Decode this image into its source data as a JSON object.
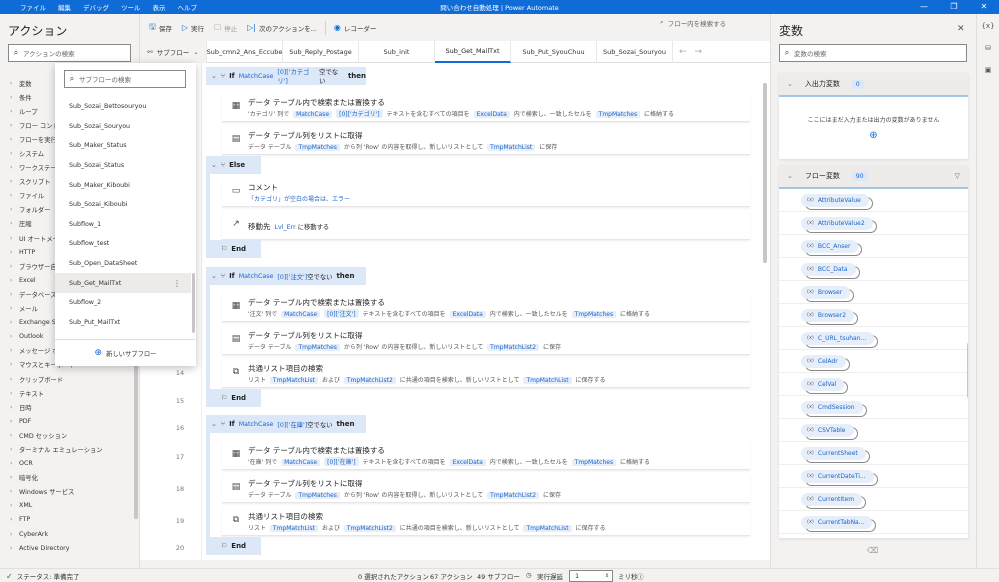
{
  "window": {
    "menu": [
      "ファイル",
      "編集",
      "デバッグ",
      "ツール",
      "表示",
      "ヘルプ"
    ],
    "title": "問い合わせ自動処理 | Power Automate",
    "controls": [
      "minimize-icon",
      "restore-icon",
      "close-icon"
    ]
  },
  "actions_panel": {
    "title": "アクション",
    "search_placeholder": "アクションの検索",
    "categories": [
      "変数",
      "条件",
      "ループ",
      "フロー コントロール",
      "フローを実行する",
      "システム",
      "ワークステーション",
      "スクリプト",
      "ファイル",
      "フォルダー",
      "圧縮",
      "UI オートメーション",
      "HTTP",
      "ブラウザー自動化",
      "Excel",
      "データベース",
      "メール",
      "Exchange Server",
      "Outlook",
      "メッセージ ボックス",
      "マウスとキーボード",
      "クリップボード",
      "テキスト",
      "日時",
      "PDF",
      "CMD セッション",
      "ターミナル エミュレーション",
      "OCR",
      "暗号化",
      "Windows サービス",
      "XML",
      "FTP",
      "CyberArk",
      "Active Directory"
    ]
  },
  "toolbar": {
    "save": "保存",
    "run": "実行",
    "stop": "停止",
    "next_action": "次のアクションを...",
    "recorder": "レコーダー",
    "flow_search_placeholder": "フロー内を検索する"
  },
  "tabs": {
    "subflow_button": "サブフロー",
    "items": [
      "Sub_cmn2_Ans_Eccube",
      "Sub_Reply_Postage",
      "Sub_init",
      "Sub_Get_MailTxt",
      "Sub_Put_SyouChuu",
      "Sub_Sozai_Souryou"
    ],
    "active_index": 3
  },
  "subflow_dropdown": {
    "search_placeholder": "サブフローの検索",
    "items": [
      "Sub_Sozai_Bettosouryou",
      "Sub_Sozai_Souryou",
      "Sub_Maker_Status",
      "Sub_Sozai_Status",
      "Sub_Maker_Kiboubi",
      "Sub_Sozai_Kiboubi",
      "Subflow_1",
      "Subflow_test",
      "Sub_Open_DataSheet",
      "Sub_Get_MailTxt",
      "Subflow_2",
      "Sub_Put_MailTxt"
    ],
    "selected_index": 9,
    "new_subflow": "新しいサブフロー"
  },
  "editor": {
    "line_numbers": [
      "14",
      "15",
      "16",
      "17",
      "18",
      "19",
      "20"
    ],
    "blocks": [
      {
        "kind": "if",
        "keyword": "If",
        "cond1": "MatchCase",
        "cond2": "[0]['カテゴリ']",
        "cond3": "空でない",
        "then": "then"
      },
      {
        "kind": "action",
        "icon": "table-icon",
        "title": "データ テーブル内で検索または置換する",
        "parts": [
          "'カテゴリ' 列で ",
          "MatchCase",
          "[0]['カテゴリ']",
          " テキストを含むすべての項目を ",
          "ExcelData",
          " 内で検索し、一致したセルを ",
          "TmpMatches",
          " に格納する"
        ]
      },
      {
        "kind": "action",
        "icon": "column-list-icon",
        "title": "データ テーブル列をリストに取得",
        "parts": [
          "データ テーブル ",
          "TmpMatches",
          " から列 'Row' の内容を取得し、新しいリストとして ",
          "TmpMatchList",
          " に保存"
        ]
      },
      {
        "kind": "else",
        "keyword": "Else"
      },
      {
        "kind": "action",
        "icon": "comment-icon",
        "title": "コメント",
        "parts": [
          "「カテゴリ」が空白の場合は、エラー"
        ]
      },
      {
        "kind": "action",
        "icon": "goto-icon",
        "title": "移動先",
        "parts": [
          "Lvl_Err",
          " に移動する"
        ]
      },
      {
        "kind": "end",
        "keyword": "End"
      },
      {
        "kind": "if",
        "keyword": "If",
        "cond1": "MatchCase",
        "cond2": "[0]['注文']",
        "cond3": "空でない",
        "then": "then"
      },
      {
        "kind": "action",
        "icon": "table-icon",
        "title": "データ テーブル内で検索または置換する",
        "parts": [
          "'注文' 列で ",
          "MatchCase",
          "[0]['注文']",
          " テキストを含むすべての項目を ",
          "ExcelData",
          " 内で検索し、一致したセルを ",
          "TmpMatches",
          " に格納する"
        ]
      },
      {
        "kind": "action",
        "icon": "column-list-icon",
        "title": "データ テーブル列をリストに取得",
        "parts": [
          "データ テーブル ",
          "TmpMatches",
          " から列 'Row' の内容を取得し、新しいリストとして ",
          "TmpMatchList2",
          " に保存"
        ]
      },
      {
        "kind": "action",
        "icon": "common-items-icon",
        "title": "共通リスト項目の検索",
        "parts": [
          "リスト ",
          "TmpMatchList",
          " および ",
          "TmpMatchList2",
          " に共通の項目を検索し、新しいリストとして ",
          "TmpMatchList",
          " に保存する"
        ]
      },
      {
        "kind": "end",
        "keyword": "End"
      },
      {
        "kind": "if",
        "keyword": "If",
        "cond1": "MatchCase",
        "cond2": "[0]['在庫']",
        "cond3": "空でない",
        "then": "then"
      },
      {
        "kind": "action",
        "icon": "table-icon",
        "title": "データ テーブル内で検索または置換する",
        "parts": [
          "'在庫' 列で ",
          "MatchCase",
          "[0]['在庫']",
          " テキストを含むすべての項目を ",
          "ExcelData",
          " 内で検索し、一致したセルを ",
          "TmpMatches",
          " に格納する"
        ]
      },
      {
        "kind": "action",
        "icon": "column-list-icon",
        "title": "データ テーブル列をリストに取得",
        "parts": [
          "データ テーブル ",
          "TmpMatches",
          " から列 'Row' の内容を取得し、新しいリストとして ",
          "TmpMatchList2",
          " に保存"
        ]
      },
      {
        "kind": "action",
        "icon": "common-items-icon",
        "title": "共通リスト項目の検索",
        "parts": [
          "リスト ",
          "TmpMatchList",
          " および ",
          "TmpMatchList2",
          " に共通の項目を検索し、新しいリストとして ",
          "TmpMatchList",
          " に保存する"
        ]
      },
      {
        "kind": "end",
        "keyword": "End"
      }
    ]
  },
  "variables_panel": {
    "title": "変数",
    "search_placeholder": "変数の検索",
    "io_section": {
      "label": "入出力変数",
      "count": "0",
      "empty_text": "ここにはまだ入力または出力の変数がありません"
    },
    "flow_section": {
      "label": "フロー変数",
      "count": "90",
      "items": [
        "AttributeValue",
        "AttributeValue2",
        "BCC_Anser",
        "BCC_Data",
        "Browser",
        "Browser2",
        "C_URL_tsuhan...",
        "CelAdr",
        "CelVal",
        "CmdSession",
        "CSVTable",
        "CurrentSheet",
        "CurrentDateTi...",
        "CurrentItem",
        "CurrentTabNa..."
      ]
    }
  },
  "status_bar": {
    "status": "ステータス: 準備完了",
    "selected": "0 選択されたアクション",
    "actions": "67 アクション",
    "subflows": "49 サブフロー",
    "delay_label": "実行遅延",
    "delay_value": "1",
    "unit": "ミリ秒"
  }
}
